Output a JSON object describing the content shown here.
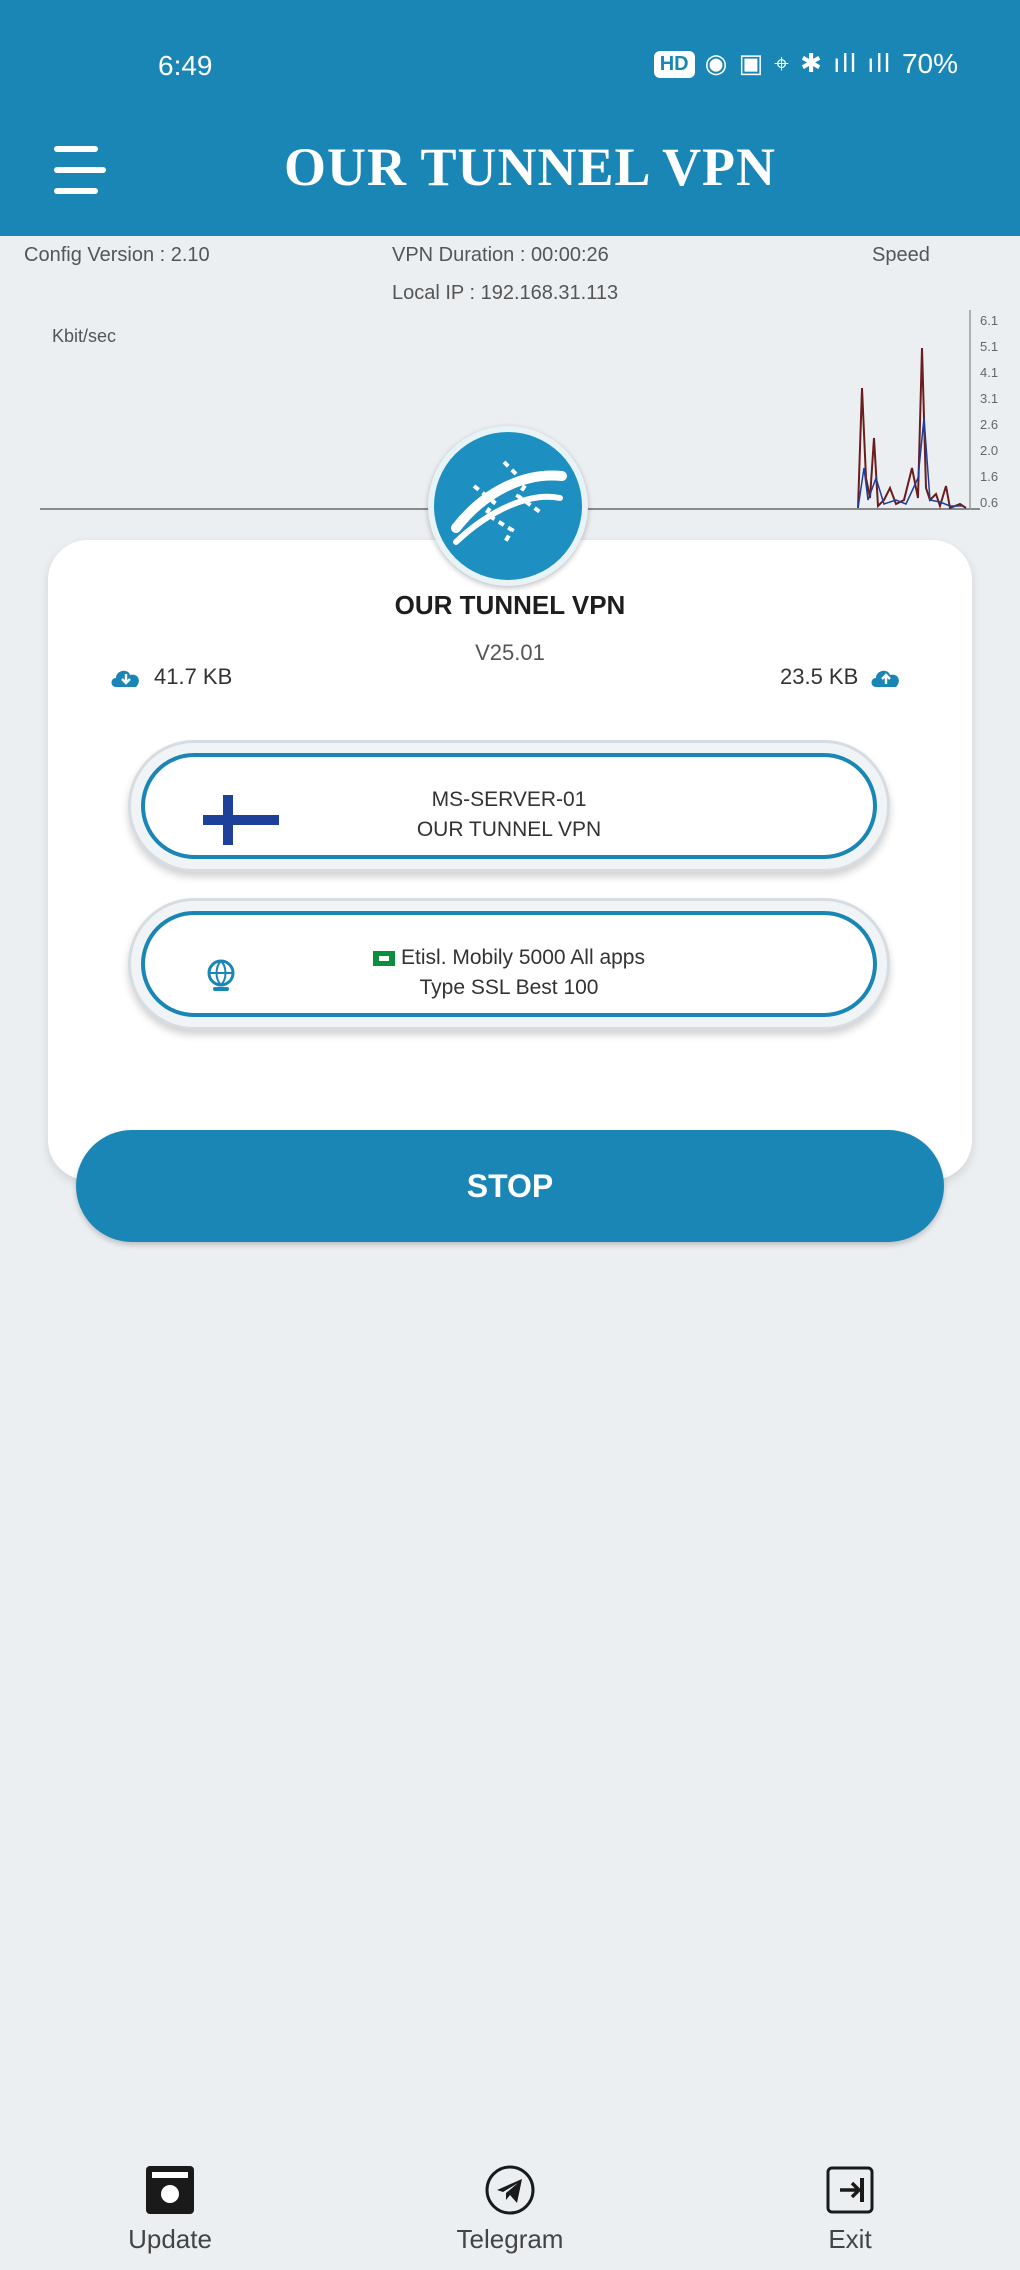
{
  "status_bar": {
    "time": "6:49",
    "indicator": "HD",
    "icons": "◉ ▣ ⌖ ✱ ıll ıll",
    "battery": "70%"
  },
  "header": {
    "menu_icon": "hamburger-menu-icon",
    "title": "OUR TUNNEL VPN"
  },
  "info_strip": {
    "config_version": "Config Version : 2.10",
    "vpn_duration": "VPN Duration : 00:00:26",
    "local_ip": "Local IP : 192.168.31.113",
    "speed": "Speed",
    "graph_label": "Kbit/sec",
    "graph_ticks": [
      "6.1",
      "5.1",
      "4.1",
      "3.1",
      "2.6",
      "2.0",
      "1.6",
      "0.6"
    ]
  },
  "card": {
    "brand_name": "OUR TUNNEL VPN",
    "version": "V25.01",
    "download": "41.7 KB",
    "upload": "23.5 KB",
    "server": {
      "name": "MS-SERVER-01",
      "provider": "OUR TUNNEL VPN",
      "flag_icon": "finland-flag-icon"
    },
    "payload": {
      "line1": "Etisl. Mobily 5000 All apps",
      "line2": "Type SSL Best 100",
      "icon": "globe-icon"
    }
  },
  "actions": {
    "stop_label": "STOP"
  },
  "bottom_nav": {
    "items": [
      {
        "label": "Update",
        "icon": "update-icon"
      },
      {
        "label": "Telegram",
        "icon": "telegram-icon"
      },
      {
        "label": "Exit",
        "icon": "exit-icon"
      }
    ]
  },
  "colors": {
    "primary": "#1a86b6",
    "background": "#eceff2",
    "card": "#ffffff"
  }
}
